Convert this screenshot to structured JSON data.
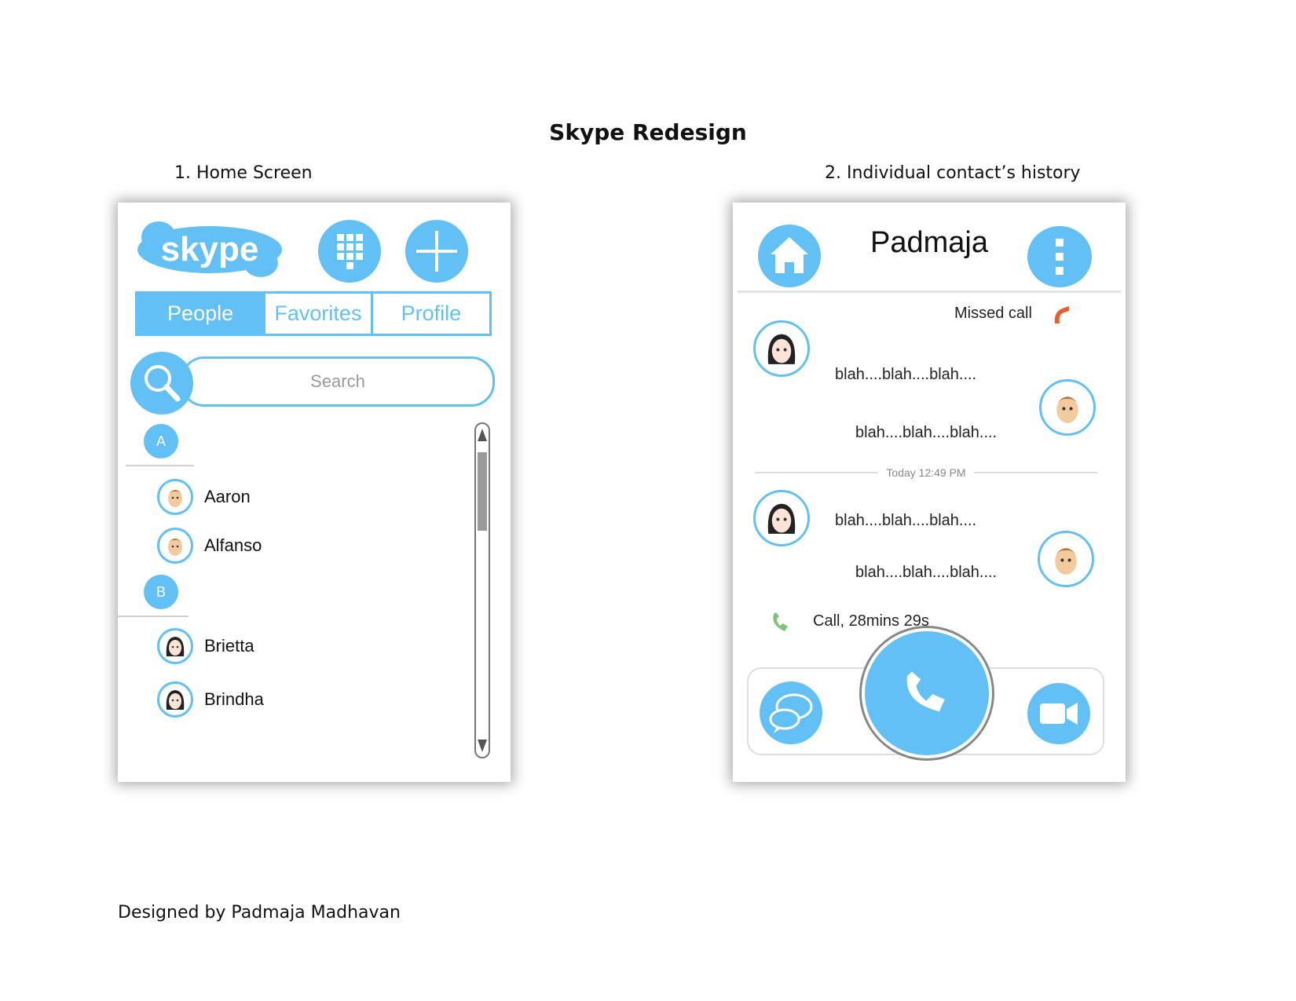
{
  "document": {
    "title": "Skype Redesign",
    "section1": "1.   Home Screen",
    "section2": "2.   Individual contact’s history",
    "credit": "Designed by Padmaja Madhavan"
  },
  "home": {
    "logo_text": "skype",
    "tabs": [
      "People",
      "Favorites",
      "Profile"
    ],
    "search_placeholder": "Search",
    "groups": [
      {
        "letter": "A",
        "contacts": [
          "Aaron",
          "Alfanso"
        ]
      },
      {
        "letter": "B",
        "contacts": [
          "Brietta",
          "Brindha"
        ]
      }
    ]
  },
  "history": {
    "contact_name": "Padmaja",
    "missed_call": "Missed call",
    "messages": [
      "blah....blah....blah....",
      "blah....blah....blah....",
      "blah....blah....blah....",
      "blah....blah....blah...."
    ],
    "timestamp": "Today 12:49 PM",
    "call_log": "Call, 28mins 29s"
  },
  "colors": {
    "accent": "#63c0f5",
    "missed": "#e5602a",
    "call": "#7cc576"
  }
}
